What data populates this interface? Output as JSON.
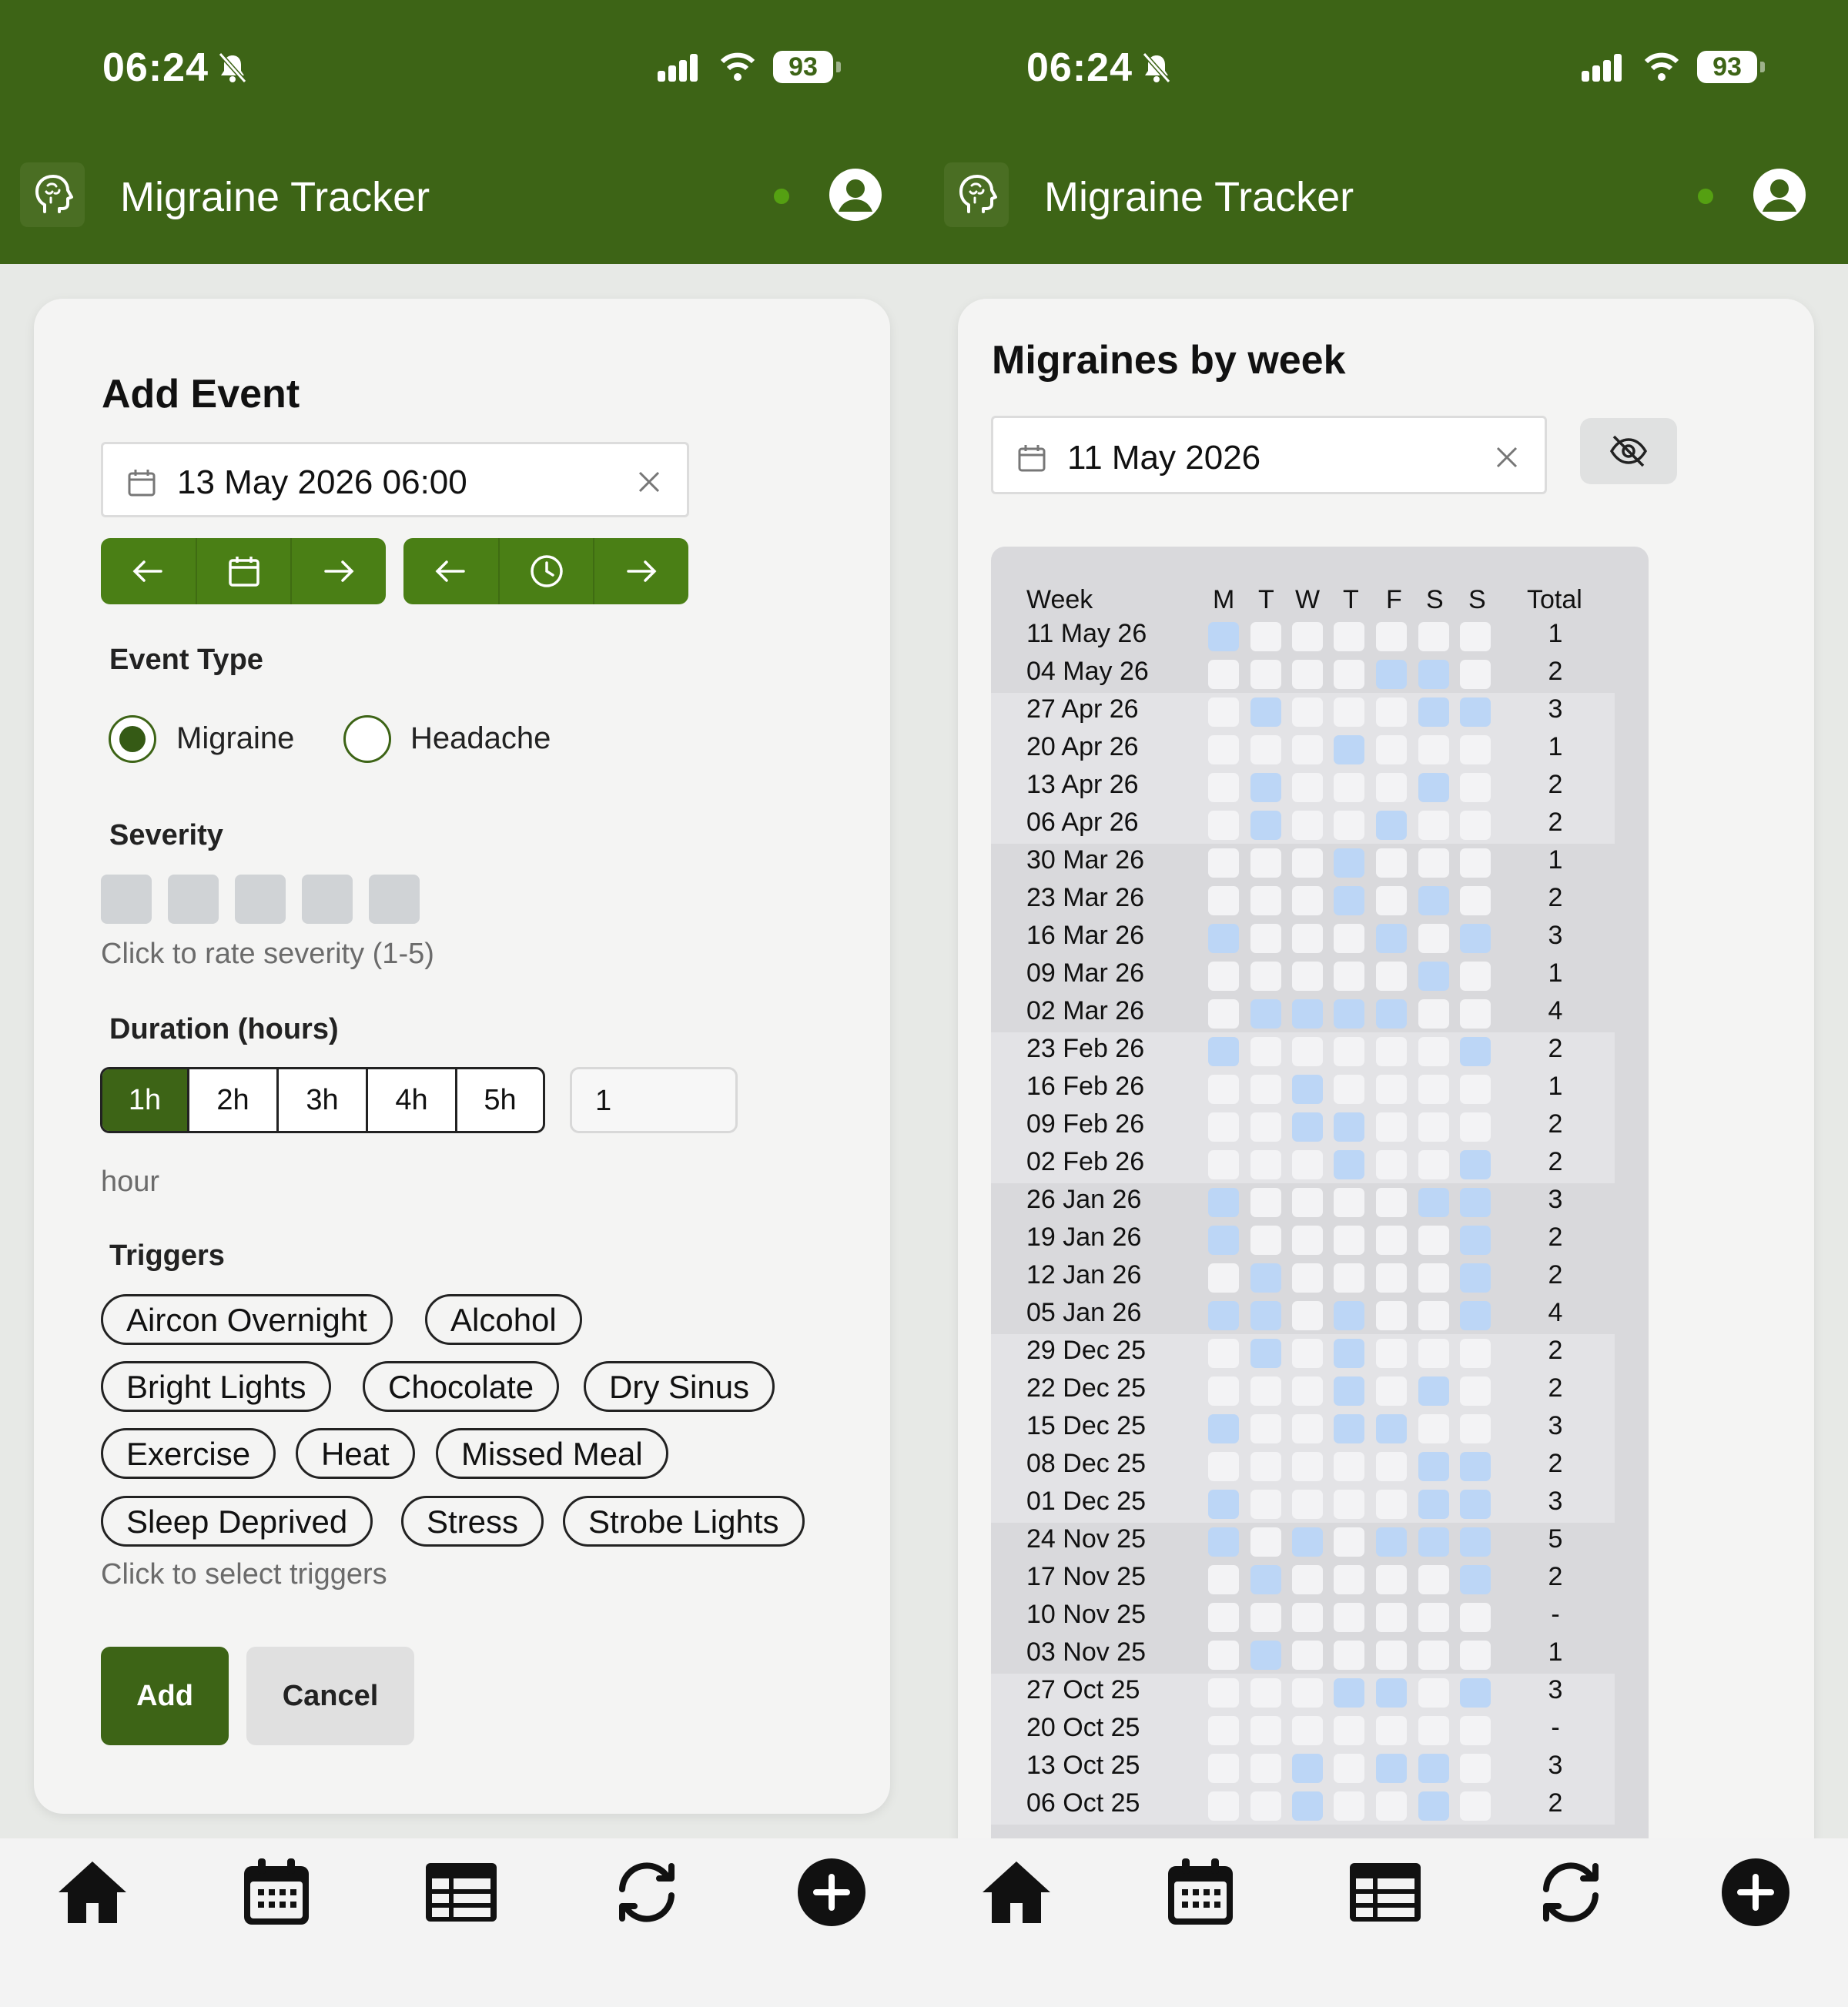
{
  "left": {
    "status": {
      "time": "06:24",
      "battery": "93"
    },
    "app": {
      "title": "Migraine Tracker"
    },
    "add_event": {
      "heading": "Add Event",
      "datetime_value": "13 May 2026 06:00",
      "event_type_label": "Event Type",
      "event_types": [
        {
          "label": "Migraine",
          "selected": true
        },
        {
          "label": "Headache",
          "selected": false
        }
      ],
      "severity_label": "Severity",
      "severity_hint": "Click to rate severity (1-5)",
      "severity_value": 0,
      "duration_label": "Duration (hours)",
      "duration_options": [
        "1h",
        "2h",
        "3h",
        "4h",
        "5h"
      ],
      "duration_selected": "1h",
      "duration_input_value": "1",
      "duration_unit": "hour",
      "triggers_label": "Triggers",
      "triggers": [
        "Aircon Overnight",
        "Alcohol",
        "Bright Lights",
        "Chocolate",
        "Dry Sinus",
        "Exercise",
        "Heat",
        "Missed Meal",
        "Sleep Deprived",
        "Stress",
        "Strobe Lights"
      ],
      "triggers_hint": "Click to select triggers",
      "add_label": "Add",
      "cancel_label": "Cancel"
    }
  },
  "right": {
    "status": {
      "time": "06:24",
      "battery": "93"
    },
    "app": {
      "title": "Migraine Tracker"
    },
    "weekly": {
      "heading": "Migraines by week",
      "date_value": "11 May 2026",
      "headers": {
        "week": "Week",
        "days": [
          "M",
          "T",
          "W",
          "T",
          "F",
          "S",
          "S"
        ],
        "total": "Total"
      },
      "rows": [
        {
          "week": "11 May 26",
          "days": [
            1,
            0,
            0,
            0,
            0,
            0,
            0
          ],
          "total": "1"
        },
        {
          "week": "04 May 26",
          "days": [
            0,
            0,
            0,
            0,
            1,
            1,
            0
          ],
          "total": "2"
        },
        {
          "week": "27 Apr 26",
          "days": [
            0,
            1,
            0,
            0,
            0,
            1,
            1
          ],
          "total": "3"
        },
        {
          "week": "20 Apr 26",
          "days": [
            0,
            0,
            0,
            1,
            0,
            0,
            0
          ],
          "total": "1"
        },
        {
          "week": "13 Apr 26",
          "days": [
            0,
            1,
            0,
            0,
            0,
            1,
            0
          ],
          "total": "2"
        },
        {
          "week": "06 Apr 26",
          "days": [
            0,
            1,
            0,
            0,
            1,
            0,
            0
          ],
          "total": "2"
        },
        {
          "week": "30 Mar 26",
          "days": [
            0,
            0,
            0,
            1,
            0,
            0,
            0
          ],
          "total": "1"
        },
        {
          "week": "23 Mar 26",
          "days": [
            0,
            0,
            0,
            1,
            0,
            1,
            0
          ],
          "total": "2"
        },
        {
          "week": "16 Mar 26",
          "days": [
            1,
            0,
            0,
            0,
            1,
            0,
            1
          ],
          "total": "3"
        },
        {
          "week": "09 Mar 26",
          "days": [
            0,
            0,
            0,
            0,
            0,
            1,
            0
          ],
          "total": "1"
        },
        {
          "week": "02 Mar 26",
          "days": [
            0,
            1,
            1,
            1,
            1,
            0,
            0
          ],
          "total": "4"
        },
        {
          "week": "23 Feb 26",
          "days": [
            1,
            0,
            0,
            0,
            0,
            0,
            1
          ],
          "total": "2"
        },
        {
          "week": "16 Feb 26",
          "days": [
            0,
            0,
            1,
            0,
            0,
            0,
            0
          ],
          "total": "1"
        },
        {
          "week": "09 Feb 26",
          "days": [
            0,
            0,
            1,
            1,
            0,
            0,
            0
          ],
          "total": "2"
        },
        {
          "week": "02 Feb 26",
          "days": [
            0,
            0,
            0,
            1,
            0,
            0,
            1
          ],
          "total": "2"
        },
        {
          "week": "26 Jan 26",
          "days": [
            1,
            0,
            0,
            0,
            0,
            1,
            1
          ],
          "total": "3"
        },
        {
          "week": "19 Jan 26",
          "days": [
            1,
            0,
            0,
            0,
            0,
            0,
            1
          ],
          "total": "2"
        },
        {
          "week": "12 Jan 26",
          "days": [
            0,
            1,
            0,
            0,
            0,
            0,
            1
          ],
          "total": "2"
        },
        {
          "week": "05 Jan 26",
          "days": [
            1,
            1,
            0,
            1,
            0,
            0,
            1
          ],
          "total": "4"
        },
        {
          "week": "29 Dec 25",
          "days": [
            0,
            1,
            0,
            1,
            0,
            0,
            0
          ],
          "total": "2"
        },
        {
          "week": "22 Dec 25",
          "days": [
            0,
            0,
            0,
            1,
            0,
            1,
            0
          ],
          "total": "2"
        },
        {
          "week": "15 Dec 25",
          "days": [
            1,
            0,
            0,
            1,
            1,
            0,
            0
          ],
          "total": "3"
        },
        {
          "week": "08 Dec 25",
          "days": [
            0,
            0,
            0,
            0,
            0,
            1,
            1
          ],
          "total": "2"
        },
        {
          "week": "01 Dec 25",
          "days": [
            1,
            0,
            0,
            0,
            0,
            1,
            1
          ],
          "total": "3"
        },
        {
          "week": "24 Nov 25",
          "days": [
            1,
            0,
            1,
            0,
            1,
            1,
            1
          ],
          "total": "5"
        },
        {
          "week": "17 Nov 25",
          "days": [
            0,
            1,
            0,
            0,
            0,
            0,
            1
          ],
          "total": "2"
        },
        {
          "week": "10 Nov 25",
          "days": [
            0,
            0,
            0,
            0,
            0,
            0,
            0
          ],
          "total": "-"
        },
        {
          "week": "03 Nov 25",
          "days": [
            0,
            1,
            0,
            0,
            0,
            0,
            0
          ],
          "total": "1"
        },
        {
          "week": "27 Oct 25",
          "days": [
            0,
            0,
            0,
            1,
            1,
            0,
            1
          ],
          "total": "3"
        },
        {
          "week": "20 Oct 25",
          "days": [
            0,
            0,
            0,
            0,
            0,
            0,
            0
          ],
          "total": "-"
        },
        {
          "week": "13 Oct 25",
          "days": [
            0,
            0,
            1,
            0,
            1,
            1,
            0
          ],
          "total": "3"
        },
        {
          "week": "06 Oct 25",
          "days": [
            0,
            0,
            1,
            0,
            0,
            1,
            0
          ],
          "total": "2"
        }
      ]
    }
  },
  "colors": {
    "brand": "#3d6416",
    "accent_green": "#4a7f15",
    "migraine_cell": "#bcd6f6",
    "empty_cell": "#f3f3f5"
  },
  "nav_icons": [
    "home-icon",
    "calendar-icon",
    "table-icon",
    "sync-icon",
    "add-circle-icon"
  ]
}
